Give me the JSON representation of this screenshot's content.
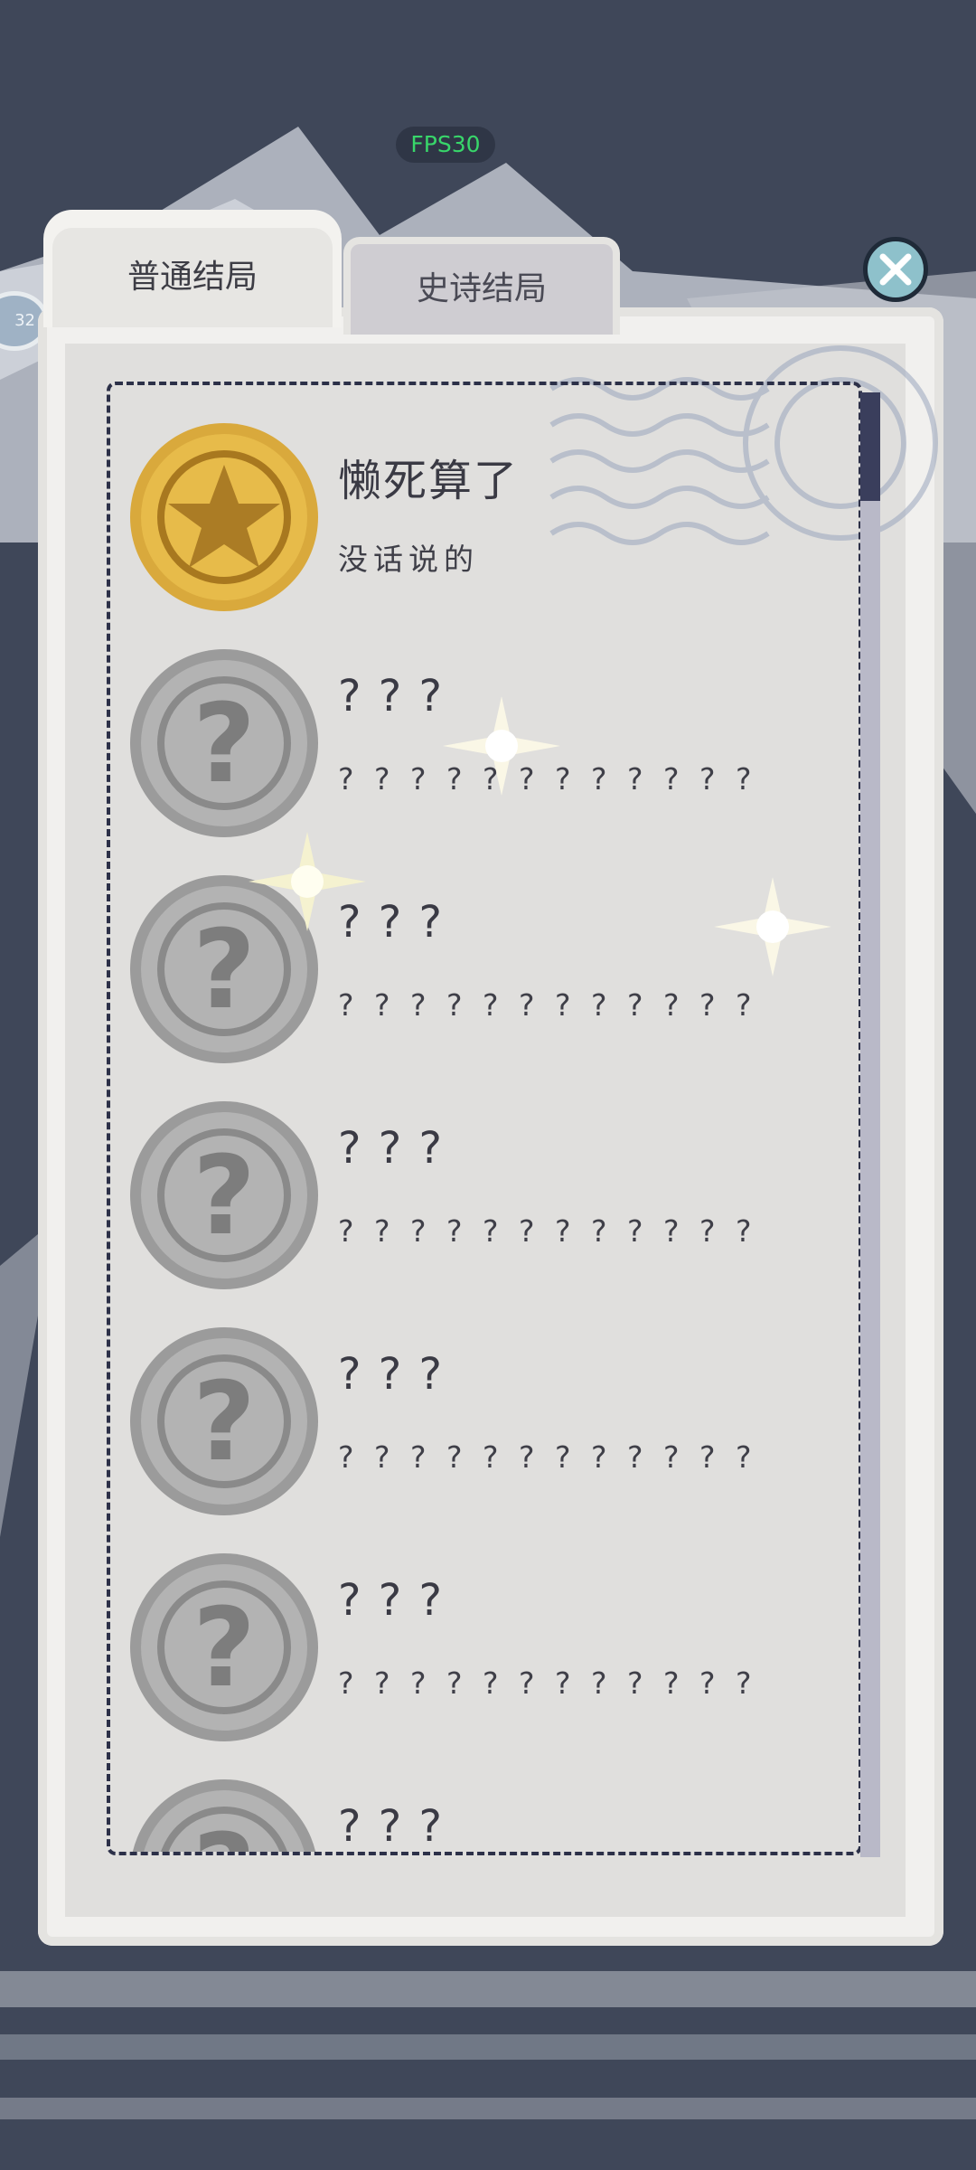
{
  "status": {
    "fps": "FPS30"
  },
  "side_badge": "32",
  "tabs": [
    {
      "label": "普通结局",
      "active": true
    },
    {
      "label": "史诗结局",
      "active": false
    }
  ],
  "close_icon": "close-icon",
  "endings": [
    {
      "title": "懒死算了",
      "desc": "没话说的",
      "unlocked": true,
      "icon": "gold-star-seal-icon"
    },
    {
      "title": "? ? ?",
      "desc": "? ? ? ? ? ? ? ? ? ? ? ?",
      "unlocked": false,
      "icon": "locked-question-seal-icon"
    },
    {
      "title": "? ? ?",
      "desc": "? ? ? ? ? ? ? ? ? ? ? ?",
      "unlocked": false,
      "icon": "locked-question-seal-icon"
    },
    {
      "title": "? ? ?",
      "desc": "? ? ? ? ? ? ? ? ? ? ? ?",
      "unlocked": false,
      "icon": "locked-question-seal-icon"
    },
    {
      "title": "? ? ?",
      "desc": "? ? ? ? ? ? ? ? ? ? ? ?",
      "unlocked": false,
      "icon": "locked-question-seal-icon"
    },
    {
      "title": "? ? ?",
      "desc": "? ? ? ? ? ? ? ? ? ? ? ?",
      "unlocked": false,
      "icon": "locked-question-seal-icon"
    },
    {
      "title": "? ? ?",
      "desc": "",
      "unlocked": false,
      "icon": "locked-question-seal-icon"
    }
  ],
  "colors": {
    "gold": "#d6a63a",
    "silver": "#9a9a9a",
    "ink": "#2c3048",
    "background": "#3b4458"
  }
}
